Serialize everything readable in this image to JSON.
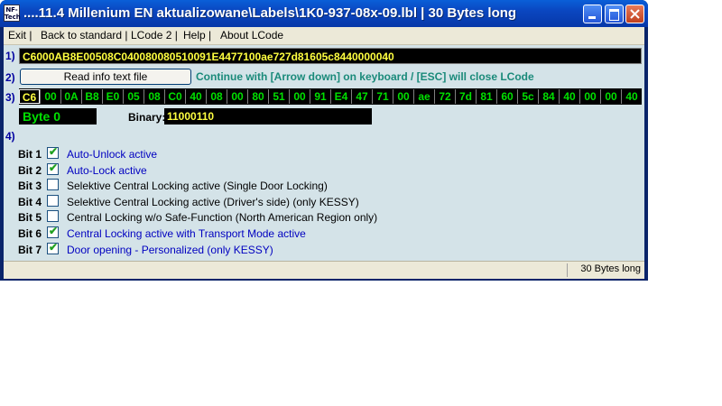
{
  "window": {
    "title": "....11.4 Millenium EN aktualizowane\\Labels\\1K0-937-08x-09.lbl | 30 Bytes long",
    "app_icon_text": "NF-Tech",
    "icons": {
      "app": "app-logo-icon",
      "minimize": "minimize-icon",
      "maximize": "maximize-icon",
      "close": "close-icon"
    }
  },
  "menu": [
    "Exit |",
    "Back to standard |",
    "LCode 2 |",
    "Help |",
    "About LCode"
  ],
  "section_numbers": [
    "1)",
    "2)",
    "3)",
    "4)"
  ],
  "coding_string": "C6000AB8E00508C040080080510091E4477100ae727d81605c8440000040",
  "read_button_label": "Read info text file",
  "hint_text": "Continue with [Arrow down] on keyboard / [ESC] will close LCode",
  "bytes": [
    "C6",
    "00",
    "0A",
    "B8",
    "E0",
    "05",
    "08",
    "C0",
    "40",
    "08",
    "00",
    "80",
    "51",
    "00",
    "91",
    "E4",
    "47",
    "71",
    "00",
    "ae",
    "72",
    "7d",
    "81",
    "60",
    "5c",
    "84",
    "40",
    "00",
    "00",
    "40"
  ],
  "selected_byte_index": 0,
  "byte_label": "Byte 0",
  "binary_label": "Binary:",
  "binary_value": "11000110",
  "bits": [
    {
      "name": "Bit 1",
      "checked": true,
      "label": "Auto-Unlock active"
    },
    {
      "name": "Bit 2",
      "checked": true,
      "label": "Auto-Lock active"
    },
    {
      "name": "Bit 3",
      "checked": false,
      "label": "Selektive Central Locking active (Single Door Locking)"
    },
    {
      "name": "Bit 4",
      "checked": false,
      "label": "Selektive Central Locking active (Driver's side) (only KESSY)"
    },
    {
      "name": "Bit 5",
      "checked": false,
      "label": "Central Locking w/o Safe-Function (North American Region only)"
    },
    {
      "name": "Bit 6",
      "checked": true,
      "label": "Central Locking active with Transport Mode active"
    },
    {
      "name": "Bit 7",
      "checked": true,
      "label": "Door opening - Personalized (only KESSY)"
    }
  ],
  "status_text": "30 Bytes long",
  "colors": {
    "accent_blue": "#0000c0",
    "hex_text": "#ffff40",
    "byte_text": "#00e000",
    "hint": "#1a8a7a"
  }
}
